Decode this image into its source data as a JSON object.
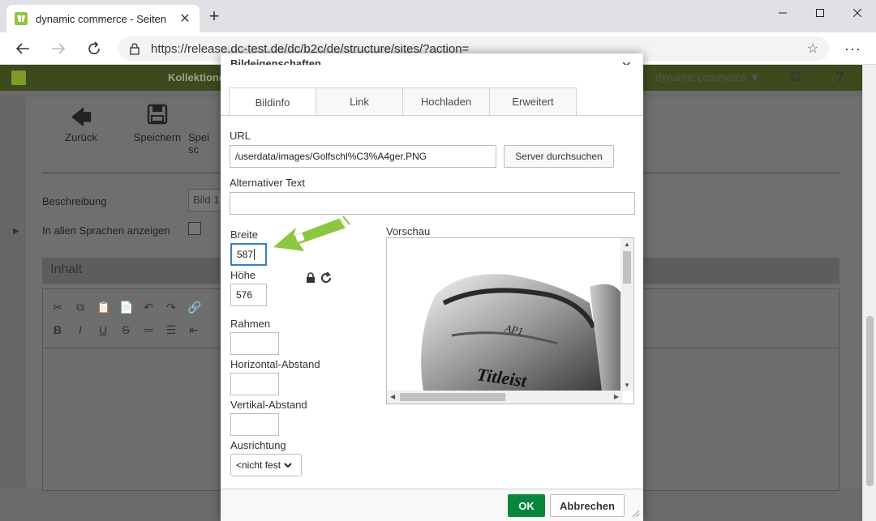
{
  "browser": {
    "tab_title": "dynamic commerce - Seiten",
    "url": "https://release.dc-test.de/dc/b2c/de/structure/sites/?action="
  },
  "app": {
    "nav_item": "Kollektionen",
    "user_menu": "dynamic commerce",
    "toolbar": {
      "back_label": "Zurück",
      "save_label": "Speichern",
      "save_close_label": "Spei sc"
    },
    "beschreibung_label": "Beschreibung",
    "beschreibung_value": "Bild 1",
    "all_languages_label": "In allen Sprachen anzeigen",
    "inhalt_label": "Inhalt"
  },
  "dialog": {
    "title": "Bildeigenschaften",
    "tabs": [
      {
        "label": "Bildinfo",
        "active": true
      },
      {
        "label": "Link",
        "active": false
      },
      {
        "label": "Hochladen",
        "active": false
      },
      {
        "label": "Erweitert",
        "active": false
      }
    ],
    "url_label": "URL",
    "url_value": "/userdata/images/Golfschl%C3%A4ger.PNG",
    "browse_button": "Server durchsuchen",
    "alt_label": "Alternativer Text",
    "alt_value": "",
    "width_label": "Breite",
    "width_value": "587",
    "height_label": "Höhe",
    "height_value": "576",
    "border_label": "Rahmen",
    "border_value": "",
    "hspace_label": "Horizontal-Abstand",
    "hspace_value": "",
    "vspace_label": "Vertikal-Abstand",
    "vspace_value": "",
    "align_label": "Ausrichtung",
    "align_value": "<nicht fest",
    "preview_label": "Vorschau",
    "preview_brand": "Titleist",
    "ok_button": "OK",
    "cancel_button": "Abbrechen"
  },
  "colors": {
    "ok_green": "#09863e",
    "focus_blue": "#3a7ec8",
    "annotation_green": "#8dc63f",
    "app_header": "#3d4a1e"
  }
}
